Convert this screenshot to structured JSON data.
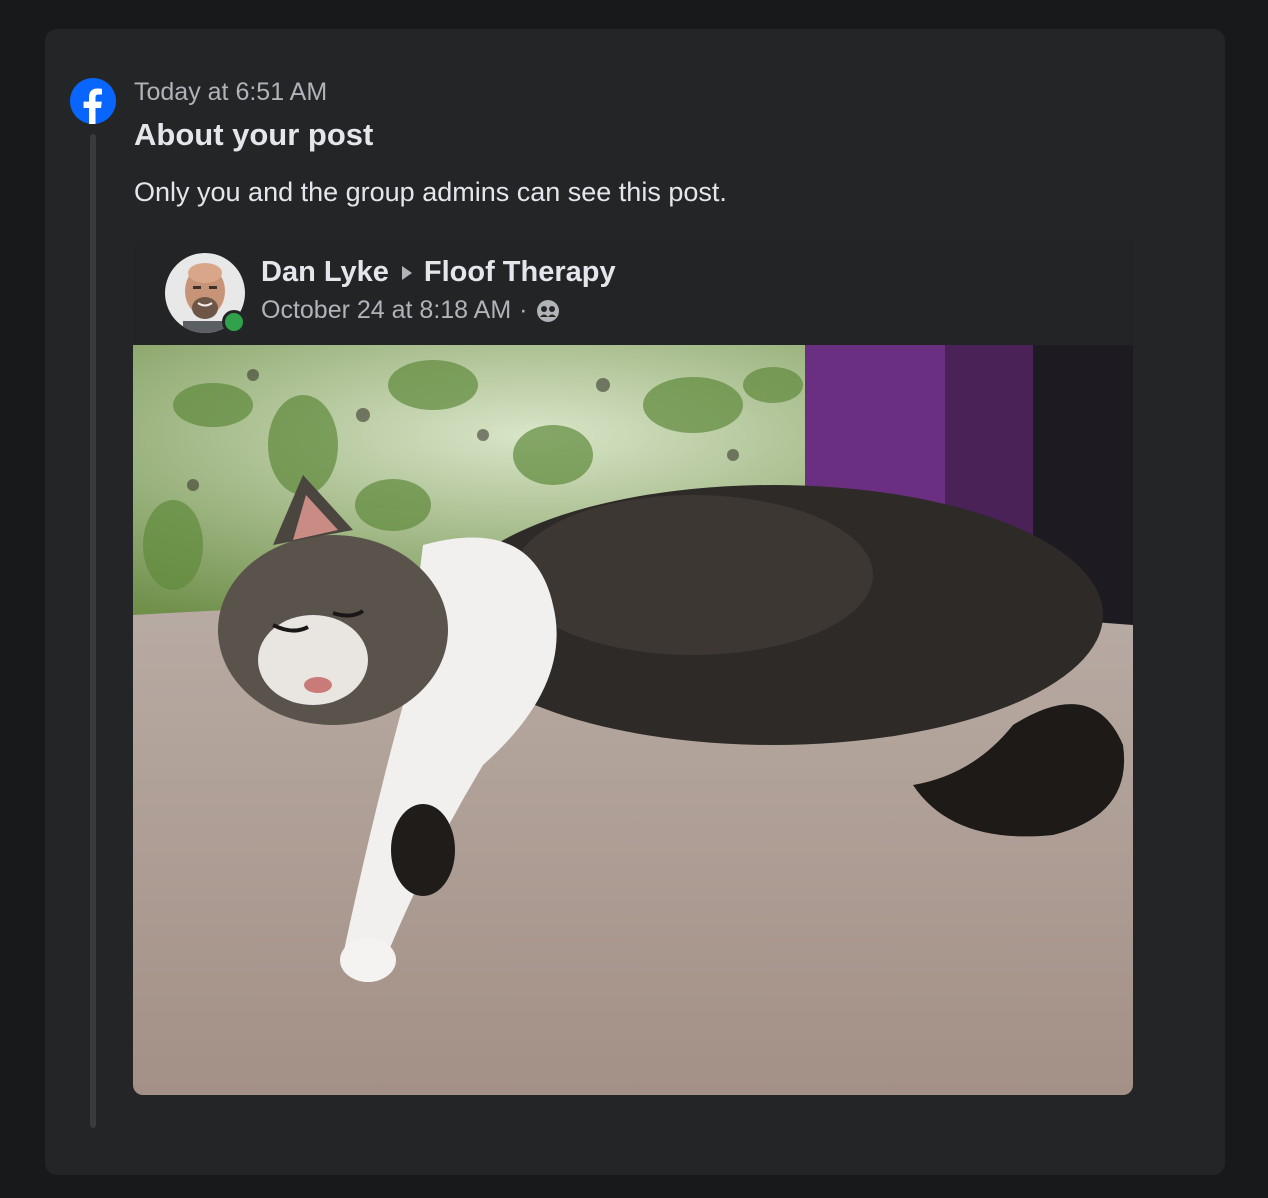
{
  "notification": {
    "timestamp": "Today at 6:51 AM",
    "title": "About your post",
    "message": "Only you and the group admins can see this post."
  },
  "post": {
    "author": "Dan Lyke",
    "group": "Floof Therapy",
    "date": "October 24 at 8:18 AM",
    "separator": "·",
    "audience_icon": "group-members-icon",
    "image_description": "photo-cat-lying-on-bed"
  },
  "colors": {
    "facebook_blue": "#0866ff",
    "online_green": "#31a24c",
    "background": "#18191a",
    "card": "#242526"
  }
}
